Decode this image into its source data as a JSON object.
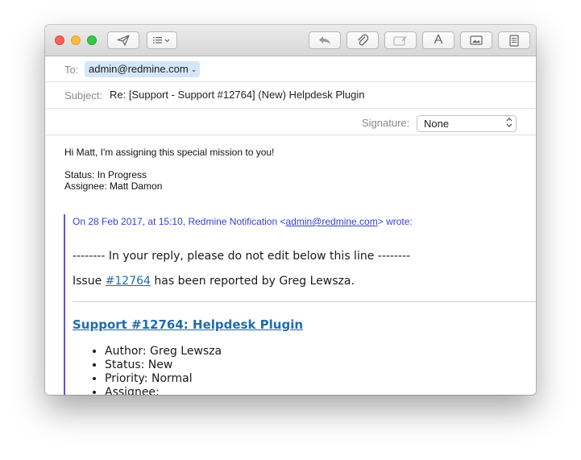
{
  "toolbar": {
    "buttons": [
      {
        "name": "send-button",
        "icon": "paper-plane-icon"
      },
      {
        "name": "header-fields-button",
        "icon": "list-icon"
      },
      {
        "name": "reply-button",
        "icon": "reply-arrow-icon"
      },
      {
        "name": "attach-button",
        "icon": "paperclip-icon"
      },
      {
        "name": "markup-button",
        "icon": "markup-icon"
      },
      {
        "name": "format-button",
        "icon": "format-text-icon",
        "glyph": "A"
      },
      {
        "name": "photo-browser-button",
        "icon": "photo-icon"
      },
      {
        "name": "stationery-button",
        "icon": "stationery-icon"
      }
    ]
  },
  "header": {
    "to_label": "To:",
    "to_address": "admin@redmine.com",
    "to_chevron": "⌄",
    "subject_label": "Subject:",
    "subject_value": "Re: [Support - Support #12764] (New) Helpdesk Plugin",
    "signature_label": "Signature:",
    "signature_value": "None"
  },
  "message": {
    "greeting": "Hi Matt, I'm assigning this special mission to you!",
    "status_line": "Status: In Progress",
    "assignee_line": "Assignee: Matt Damon"
  },
  "quote": {
    "intro_before": "On 28 Feb 2017, at 15:10, Redmine Notification <",
    "intro_email": "admin@redmine.com",
    "intro_after": "> wrote:",
    "separator_line": "-------- In your reply, please do not edit below this line --------",
    "issue_prefix": "Issue ",
    "issue_link": "#12764",
    "issue_suffix": " has been reported by Greg Lewsza.",
    "issue_title": "Support #12764: Helpdesk Plugin",
    "details": [
      "Author: Greg Lewsza",
      "Status: New",
      "Priority: Normal",
      "Assignee:"
    ]
  },
  "colors": {
    "quote_bar": "#5b57d6",
    "link": "#1f6bb0",
    "to_chip": "#d4e6f8"
  }
}
